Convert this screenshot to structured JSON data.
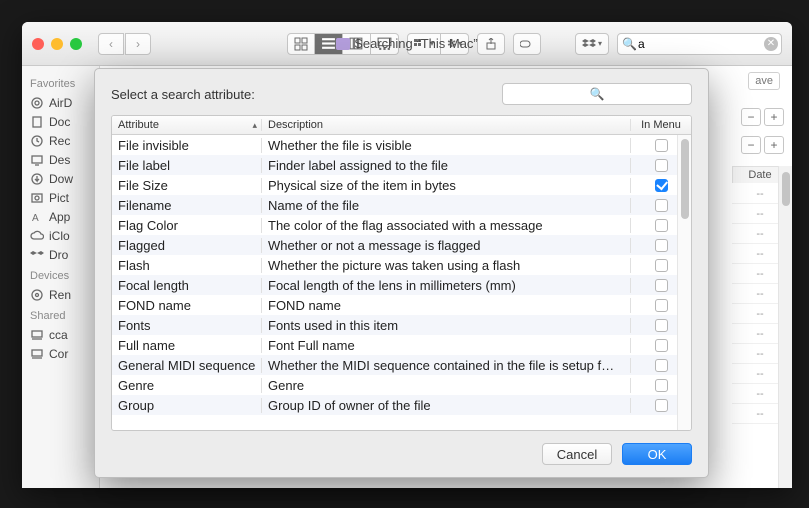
{
  "window": {
    "title": "Searching “This Mac”",
    "search_value": "a"
  },
  "sidebar": {
    "favorites_hdr": "Favorites",
    "devices_hdr": "Devices",
    "shared_hdr": "Shared",
    "items": [
      {
        "label": "AirD",
        "icon": "airdrop"
      },
      {
        "label": "Doc",
        "icon": "doc"
      },
      {
        "label": "Rec",
        "icon": "recent"
      },
      {
        "label": "Des",
        "icon": "desktop"
      },
      {
        "label": "Dow",
        "icon": "downloads"
      },
      {
        "label": "Pict",
        "icon": "pictures"
      },
      {
        "label": "App",
        "icon": "apps"
      },
      {
        "label": "iClo",
        "icon": "icloud"
      },
      {
        "label": "Dro",
        "icon": "dropbox"
      }
    ],
    "devices": [
      {
        "label": "Ren",
        "icon": "disc"
      }
    ],
    "shared": [
      {
        "label": "cca",
        "icon": "computer"
      },
      {
        "label": "Cor",
        "icon": "computer"
      }
    ]
  },
  "dialog": {
    "prompt": "Select a search attribute:",
    "col_attr": "Attribute",
    "col_desc": "Description",
    "col_menu": "In Menu",
    "rows": [
      {
        "attr": "File invisible",
        "desc": "Whether the file is visible",
        "on": false
      },
      {
        "attr": "File label",
        "desc": "Finder label assigned to the file",
        "on": false
      },
      {
        "attr": "File Size",
        "desc": "Physical size of the item in bytes",
        "on": true
      },
      {
        "attr": "Filename",
        "desc": "Name of the file",
        "on": false
      },
      {
        "attr": "Flag Color",
        "desc": "The color of the flag associated with a message",
        "on": false
      },
      {
        "attr": "Flagged",
        "desc": "Whether or not a message is flagged",
        "on": false
      },
      {
        "attr": "Flash",
        "desc": "Whether the picture was taken using a flash",
        "on": false
      },
      {
        "attr": "Focal length",
        "desc": "Focal length of the lens in millimeters (mm)",
        "on": false
      },
      {
        "attr": "FOND name",
        "desc": "FOND name",
        "on": false
      },
      {
        "attr": "Fonts",
        "desc": "Fonts used in this item",
        "on": false
      },
      {
        "attr": "Full name",
        "desc": "Font Full name",
        "on": false
      },
      {
        "attr": "General MIDI sequence",
        "desc": "Whether the MIDI sequence contained in the file is setup f…",
        "on": false
      },
      {
        "attr": "Genre",
        "desc": "Genre",
        "on": false
      },
      {
        "attr": "Group",
        "desc": "Group ID of owner of the file",
        "on": false
      }
    ],
    "cancel": "Cancel",
    "ok": "OK"
  },
  "right": {
    "save": "ave",
    "date_hdr": "Date",
    "dash": "--"
  }
}
